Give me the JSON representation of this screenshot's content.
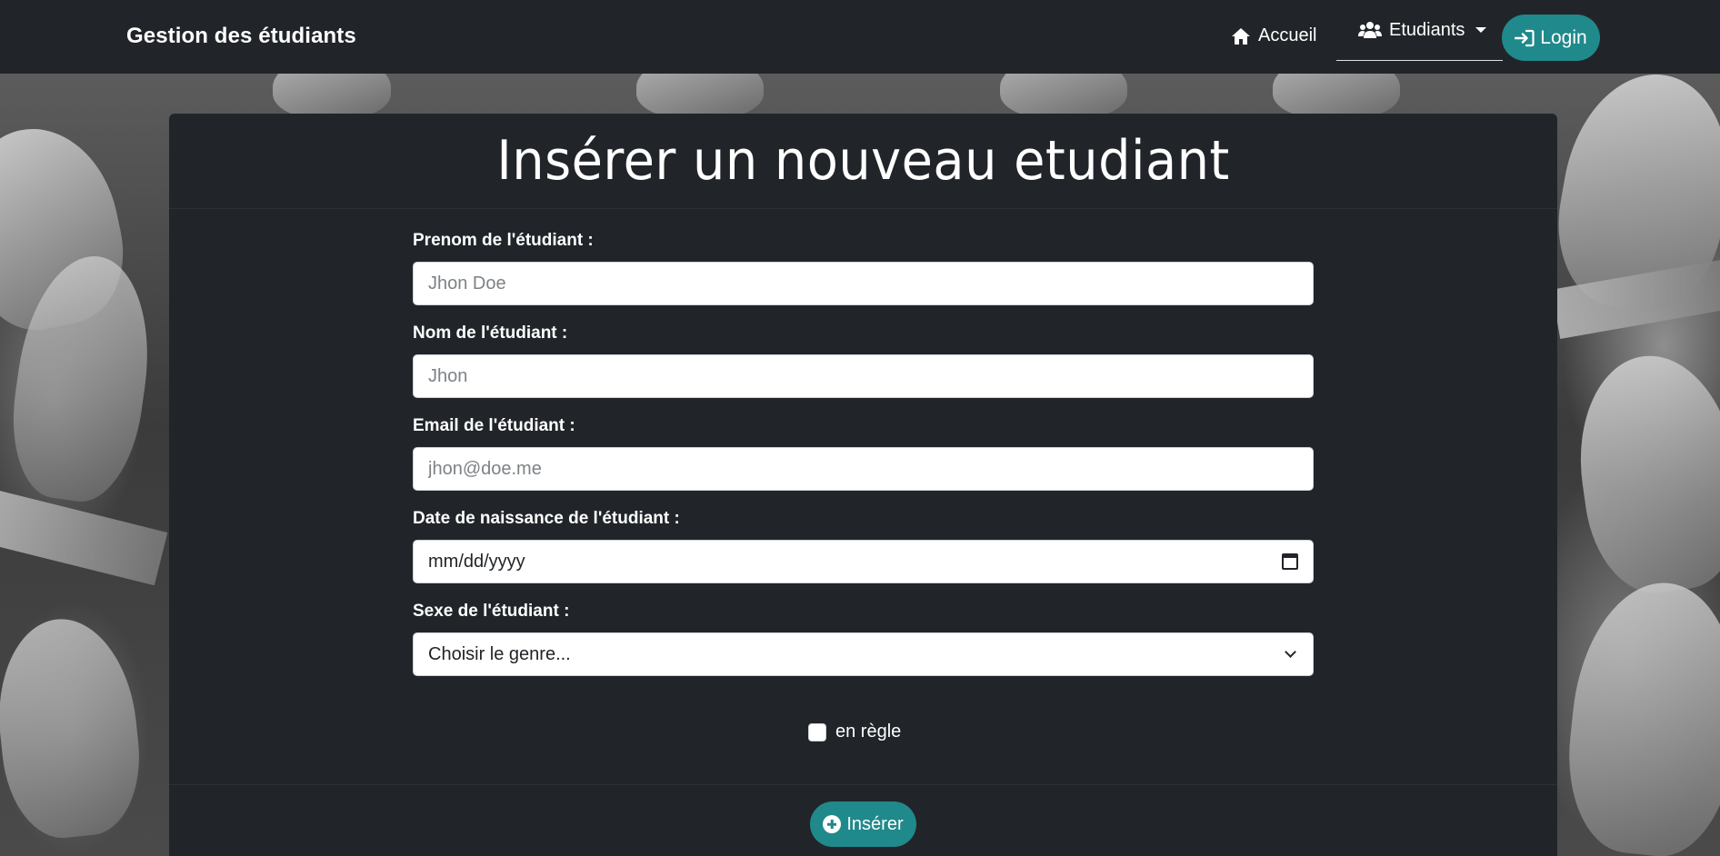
{
  "navbar": {
    "brand": "Gestion des étudiants",
    "home_label": "Accueil",
    "home_icon": "home-icon",
    "students_label": "Etudiants",
    "students_icon": "users-icon",
    "login_label": "Login",
    "login_icon": "sign-in-icon"
  },
  "card": {
    "title": "Insérer un nouveau etudiant"
  },
  "form": {
    "firstname": {
      "label": "Prenom de l'étudiant :",
      "placeholder": "Jhon Doe",
      "value": ""
    },
    "lastname": {
      "label": "Nom de l'étudiant :",
      "placeholder": "Jhon",
      "value": ""
    },
    "email": {
      "label": "Email de l'étudiant :",
      "placeholder": "jhon@doe.me",
      "value": ""
    },
    "birthdate": {
      "label": "Date de naissance de l'étudiant :",
      "display": "mm/dd/yyyy"
    },
    "gender": {
      "label": "Sexe de l'étudiant :",
      "selected": "Choisir le genre..."
    },
    "status_checkbox": {
      "label": "en règle",
      "checked": false
    },
    "submit_label": "Insérer",
    "submit_icon": "plus-circle-icon"
  },
  "colors": {
    "navbar_bg": "#212529",
    "accent": "#20898b",
    "text": "#ffffff"
  }
}
